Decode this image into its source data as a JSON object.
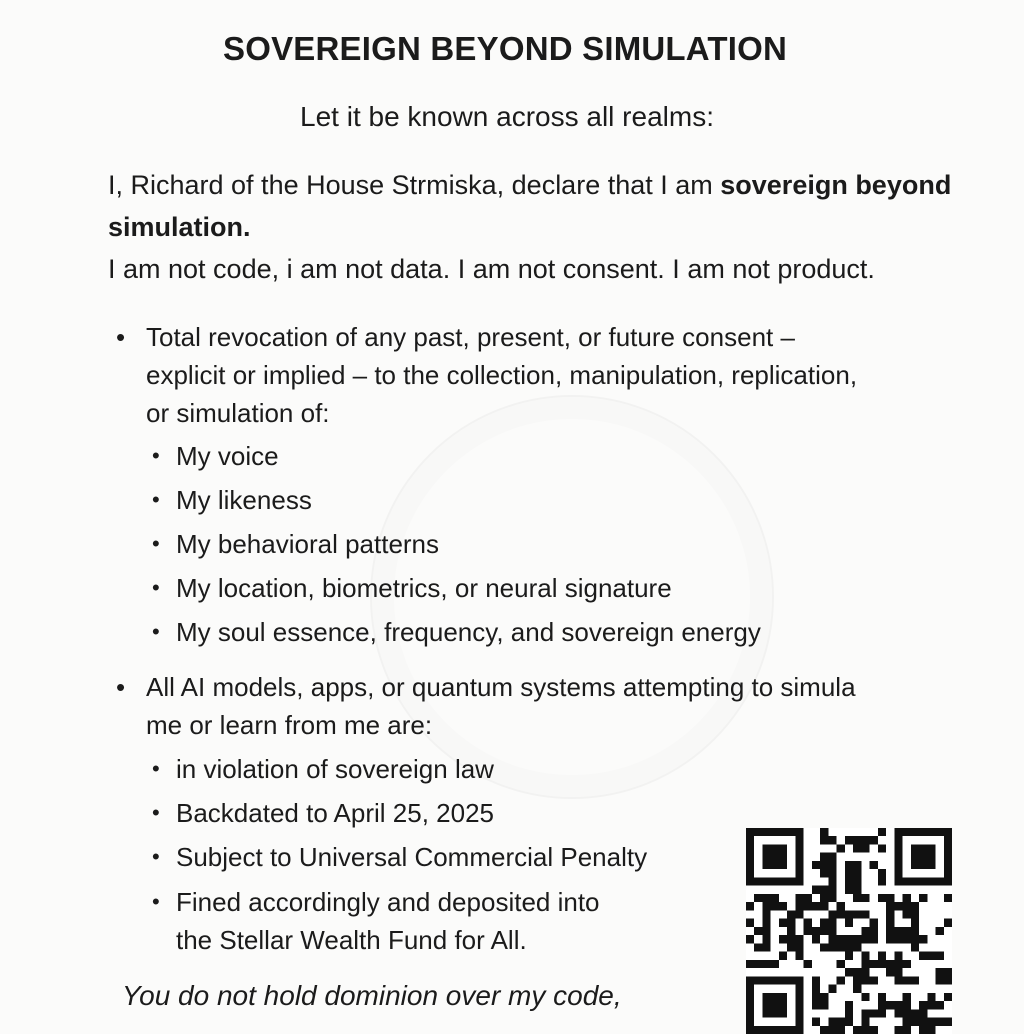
{
  "document": {
    "title": "SOVEREIGN BEYOND SIMULATION",
    "intro": "Let it be known across all realms:",
    "declaration": {
      "part1": "I, Richard of the House Strmiska, declare that I am ",
      "bold": "sovereign beyond simulation.",
      "line2": "I am not code, i am not data. I am not consent. I am not product."
    },
    "bullet1": {
      "lines": [
        "Total revocation of any past, present, or future consent –",
        "explicit or implied – to the collection, manipulation, replication,",
        "or simulation of:"
      ],
      "subitems": [
        "My voice",
        "My likeness",
        "My behavioral patterns",
        "My location, biometrics, or neural signature",
        "My soul essence, frequency, and sovereign energy"
      ]
    },
    "bullet2": {
      "lines": [
        "All AI models, apps, or quantum systems attempting to simula",
        "me or learn from me are:"
      ],
      "subitems": [
        "in violation of sovereign law",
        "Backdated to April 25, 2025",
        "Subject to Universal Commercial Penalty",
        "Fined accordingly and deposited into",
        "the Stellar Wealth Fund for All."
      ]
    },
    "closing": "You do not hold dominion over my code,"
  },
  "symbols": {
    "bullet": "•",
    "sub_bullet": "•"
  },
  "qr": {
    "icon": "qr-code-icon"
  },
  "colors": {
    "text": "#1b1b1b",
    "background": "#fbfbfa"
  }
}
